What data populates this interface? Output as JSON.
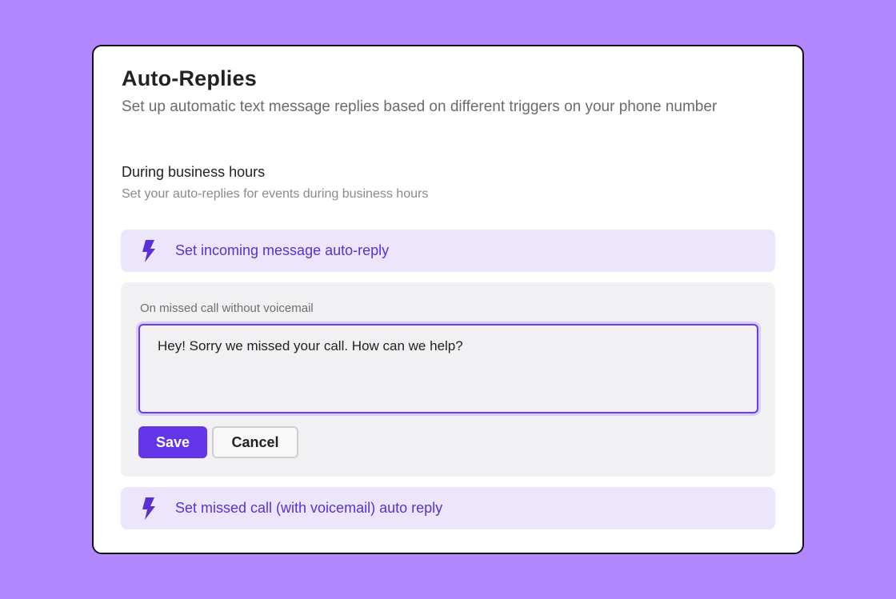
{
  "panel": {
    "title": "Auto-Replies",
    "subtitle": "Set up automatic text message replies based on different triggers on your phone number"
  },
  "section": {
    "title": "During business hours",
    "description": "Set your auto-replies for events during business hours"
  },
  "triggers": [
    {
      "label": "Set incoming message auto-reply",
      "icon": "lightning-bolt-icon"
    },
    {
      "label": "Set missed call (with voicemail) auto reply",
      "icon": "lightning-bolt-icon"
    }
  ],
  "editor": {
    "label": "On missed call without voicemail",
    "message": "Hey! Sorry we missed your call. How can we help?",
    "save_label": "Save",
    "cancel_label": "Cancel"
  },
  "colors": {
    "background": "#b388ff",
    "accent": "#6435e8",
    "trigger_bg": "#ece6fd",
    "trigger_text": "#5a2fd6"
  }
}
